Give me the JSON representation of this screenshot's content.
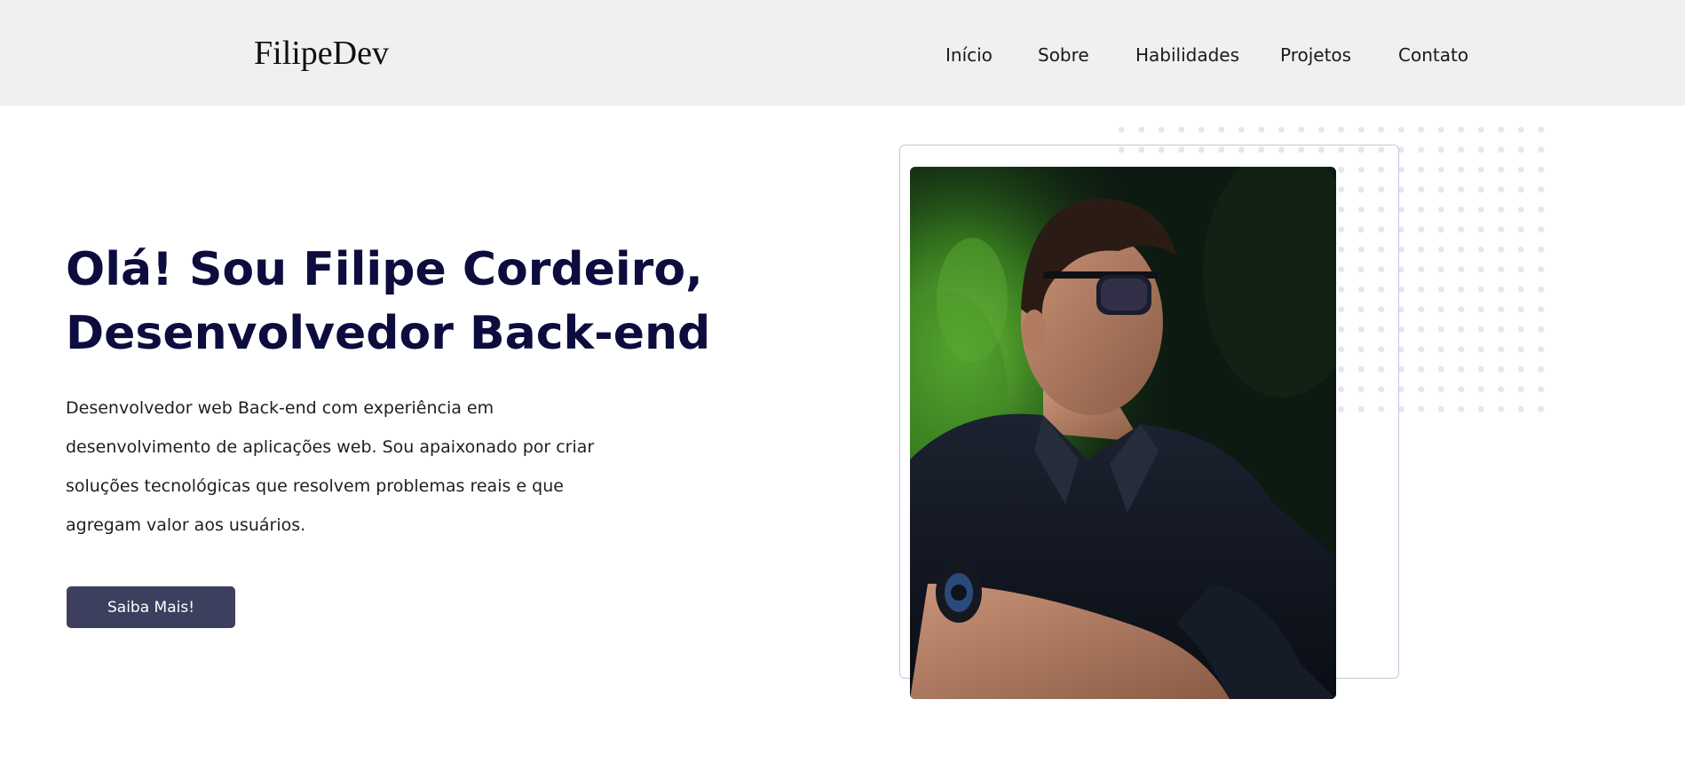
{
  "header": {
    "logo": "FilipeDev",
    "nav": [
      {
        "label": "Início"
      },
      {
        "label": "Sobre"
      },
      {
        "label": "Habilidades"
      },
      {
        "label": "Projetos"
      },
      {
        "label": "Contato"
      }
    ]
  },
  "hero": {
    "title_line1": "Olá! Sou Filipe Cordeiro,",
    "title_line2": "Desenvolvedor Back-end",
    "description": "Desenvolvedor web Back-end com experiência em desenvolvimento de aplicações web. Sou apaixonado por criar soluções tecnológicas que resolvem problemas reais e que agregam valor aos usuários.",
    "cta_label": "Saiba Mais!"
  },
  "colors": {
    "header_bg": "#f0f0f0",
    "title": "#0c0c3e",
    "button_bg": "#3c3f5e",
    "dots": "#e6e6ee",
    "frame_border": "#c3c8dc"
  }
}
